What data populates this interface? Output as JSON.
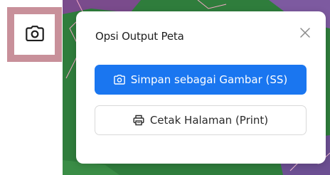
{
  "tool_button": {
    "icon": "camera-icon"
  },
  "popup": {
    "title": "Opsi Output Peta",
    "close_icon": "close-icon",
    "primary_button": {
      "label": "Simpan sebagai Gambar (SS)",
      "icon": "camera-icon"
    },
    "secondary_button": {
      "label": "Cetak Halaman (Print)",
      "icon": "printer-icon"
    }
  },
  "colors": {
    "accent": "#1a76f0",
    "tool_button_bg": "#c8909a",
    "map_green": "#2f7d3c"
  }
}
